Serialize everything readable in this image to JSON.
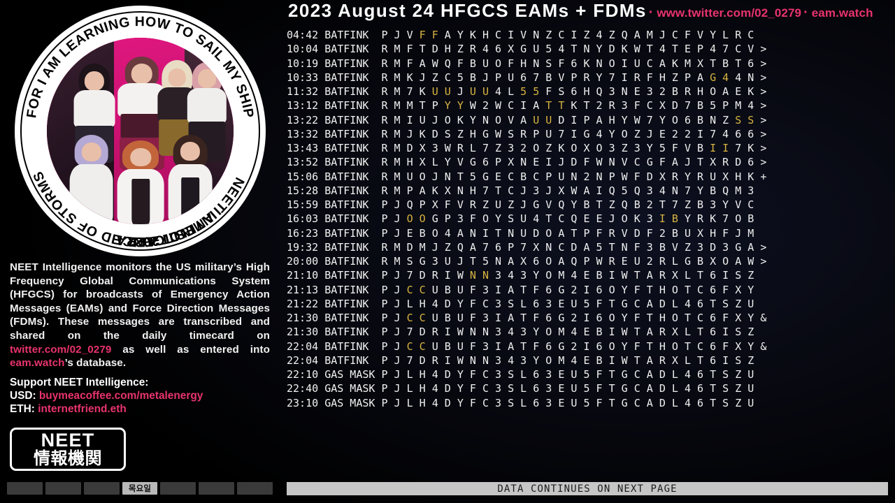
{
  "emblem": {
    "ring_text_top": "FOR I AM LEARNING HOW TO SAIL MY SHIP",
    "ring_text_bottom": "I AM NOT AFRAID OF STORMS",
    "ring_text_right": "NEET INTELLIGENCE",
    "ring_text_est": "EST. 2022",
    "image_alt": "kpop-group-photo"
  },
  "description": {
    "part1": "NEET Intelligence monitors the US military’s High Frequency Global Communications System (HFGCS) for broadcasts of Emergency Action Messages (EAMs) and Force Direction Messages (FDMs). These messages are transcribed and shared on the daily timecard on ",
    "link1": "twitter.com/02_0279",
    "part2": " as well as entered into ",
    "link2": "eam.watch",
    "part3": "’s database."
  },
  "support": {
    "title": "Support NEET Intelligence:",
    "usd_label": "USD:",
    "usd_value": "buymeacoffee.com/metalenergy",
    "eth_label": "ETH:",
    "eth_value": "internetfriend.eth"
  },
  "badge": {
    "line1": "NEET",
    "line2": "情報機関"
  },
  "daybar": {
    "segments": [
      "",
      "",
      "",
      "목요일",
      "",
      "",
      ""
    ],
    "active_index": 3
  },
  "header": {
    "year": "2023",
    "month": "August",
    "day": "24",
    "system": "HFGCS",
    "kinds": "EAMs + FDMs",
    "title": "2023  August  24  HFGCS  EAMs + FDMs",
    "sep": "·",
    "link1": "www.twitter.com/02_0279",
    "link2": "eam.watch"
  },
  "footer": {
    "continues": "DATA CONTINUES ON NEXT PAGE"
  },
  "colors": {
    "accent_pink": "#e8336d",
    "highlight_gold": "#d8b441",
    "text": "#f0f0f0",
    "background": "#000000",
    "bar_grey": "#c6c6c6"
  },
  "messages": {
    "columns": [
      "time",
      "callsign",
      "characters"
    ],
    "rows": [
      {
        "time": "04:42",
        "callsign": "BATFINK",
        "chars": "PJVFFAYKHCIVNZCIZ4ZQAMJCFVYLRC",
        "highlights": [
          3,
          4
        ],
        "tail": ""
      },
      {
        "time": "10:04",
        "callsign": "BATFINK",
        "chars": "RMFTDHZR46XGU54TNYDKWT4TEP47CV",
        "highlights": [],
        "tail": ">"
      },
      {
        "time": "10:19",
        "callsign": "BATFINK",
        "chars": "RMFAWQFBUOFHNSF6KNOIUCAKMXTBT6",
        "highlights": [],
        "tail": ">"
      },
      {
        "time": "10:33",
        "callsign": "BATFINK",
        "chars": "RMKJZC5BJPU67BVPRY7IRFHZPAG44N",
        "highlights": [
          26,
          27
        ],
        "tail": ">"
      },
      {
        "time": "11:32",
        "callsign": "BATFINK",
        "chars": "RM7KUUJUU4L55FS6HQ3NE32BRHOAEK",
        "highlights": [
          4,
          5,
          7,
          8,
          11,
          12
        ],
        "tail": ">"
      },
      {
        "time": "13:12",
        "callsign": "BATFINK",
        "chars": "RMMTPYYW2WCIATTKT2R3FCXD7B5PM4",
        "highlights": [
          5,
          6,
          13,
          14
        ],
        "tail": ">"
      },
      {
        "time": "13:22",
        "callsign": "BATFINK",
        "chars": "RMIUJOKYNOVAUUDIPAHYW7YO6BNZSS",
        "highlights": [
          12,
          13,
          28,
          29
        ],
        "tail": ">"
      },
      {
        "time": "13:32",
        "callsign": "BATFINK",
        "chars": "RMJKDSZHGWSRPU7IG4YOZJE22I74 66",
        "highlights": [],
        "tail": ">"
      },
      {
        "time": "13:43",
        "callsign": "BATFINK",
        "chars": "RMDX3WRL7Z32OZKOXO3Z3Y5FVBII7K",
        "highlights": [
          26,
          27
        ],
        "tail": ">"
      },
      {
        "time": "13:52",
        "callsign": "BATFINK",
        "chars": "RMHXLYVG6PXNEIJDFWNVCGFAJTXRD6",
        "highlights": [],
        "tail": ">"
      },
      {
        "time": "15:06",
        "callsign": "BATFINK",
        "chars": "RMUOJNT5GECBCPUN2NPWFDXRYRUXHK",
        "highlights": [],
        "tail": "+"
      },
      {
        "time": "15:28",
        "callsign": "BATFINK",
        "chars": "RMPAKXNH7TCJ3JXWAIQ5Q34N7YBQM3",
        "highlights": [],
        "tail": ""
      },
      {
        "time": "15:59",
        "callsign": "BATFINK",
        "chars": "PJQPXFVRZUZJGVQYBTZQB2T7ZB3YVC",
        "highlights": [],
        "tail": ""
      },
      {
        "time": "16:03",
        "callsign": "BATFINK",
        "chars": "PJOOGP3FOYSU4TCQEEJOK3IBYRK7OB",
        "highlights": [
          2,
          3,
          22,
          23
        ],
        "tail": ""
      },
      {
        "time": "16:23",
        "callsign": "BATFINK",
        "chars": "PJEBO4ANITNUDOATPFRVDF2BUXHFJM",
        "highlights": [],
        "tail": ""
      },
      {
        "time": "19:32",
        "callsign": "BATFINK",
        "chars": "RMDMJZQA76P7XNCDA5TNF3BVZ3D3GA",
        "highlights": [],
        "tail": ">"
      },
      {
        "time": "20:00",
        "callsign": "BATFINK",
        "chars": "RMSG3UJT5NAX6OAQPWREU2RLGBXOAW",
        "highlights": [],
        "tail": ">"
      },
      {
        "time": "21:10",
        "callsign": "BATFINK",
        "chars": "PJ7DRIWNN343YOM4EBIWTARXLT6ISZ",
        "highlights": [
          7,
          8
        ],
        "tail": ""
      },
      {
        "time": "21:13",
        "callsign": "BATFINK",
        "chars": "PJCCUBUF3IATF6G2I6OYFTHOTC6FXY",
        "highlights": [
          2,
          3
        ],
        "tail": ""
      },
      {
        "time": "21:22",
        "callsign": "BATFINK",
        "chars": "PJLH4DYFC3SL63EU5FTGCADL46TSZU",
        "highlights": [],
        "tail": ""
      },
      {
        "time": "21:30",
        "callsign": "BATFINK",
        "chars": "PJCCUBUF3IATF6G2I6OYFTHOTC6FXY",
        "highlights": [
          2,
          3
        ],
        "tail": "&"
      },
      {
        "time": "21:30",
        "callsign": "BATFINK",
        "chars": "PJ7DRIWNN343YOM4EBIWTARXLT6ISZ",
        "highlights": [],
        "tail": ""
      },
      {
        "time": "22:04",
        "callsign": "BATFINK",
        "chars": "PJCCUBUF3IATF6G2I6OYFTHOTC6FXY",
        "highlights": [
          2,
          3
        ],
        "tail": "&"
      },
      {
        "time": "22:04",
        "callsign": "BATFINK",
        "chars": "PJ7DRIWNN343YOM4EBIWTARXLT6ISZ",
        "highlights": [],
        "tail": ""
      },
      {
        "time": "22:10",
        "callsign": "GAS MASK",
        "chars": "PJLH4DYFC3SL63EU5FTGCADL46TSZU",
        "highlights": [],
        "tail": ""
      },
      {
        "time": "22:40",
        "callsign": "GAS MASK",
        "chars": "PJLH4DYFC3SL63EU5FTGCADL46TSZU",
        "highlights": [],
        "tail": ""
      },
      {
        "time": "23:10",
        "callsign": "GAS MASK",
        "chars": "PJLH4DYFC3SL63EU5FTGCADL46TSZU",
        "highlights": [],
        "tail": ""
      }
    ]
  }
}
